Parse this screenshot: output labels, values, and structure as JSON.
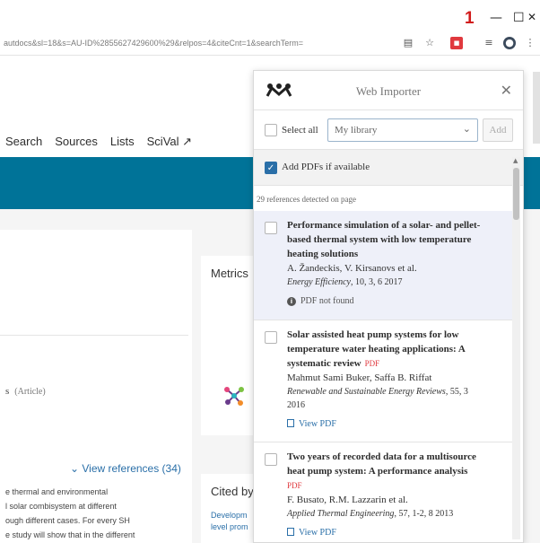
{
  "browser": {
    "annotation_badge": "1",
    "window_buttons": [
      "—",
      "☐",
      "✕"
    ],
    "url": "autdocs&sl=18&s=AU-ID%2855627429600%29&relpos=4&citeCnt=1&searchTerm=",
    "extension_icons": [
      "translate-icon",
      "star-icon",
      "pdf-extension-icon",
      "reading-list-icon",
      "profile-icon",
      "menu-icon"
    ]
  },
  "page": {
    "nav": [
      "Search",
      "Sources",
      "Lists",
      "SciVal ↗"
    ],
    "doc_type_prefix": "s",
    "doc_type": "(Article)",
    "view_references": "⌄ View references (34)",
    "abstract_lines": [
      "e thermal and environmental",
      "l solar combisystem at different",
      "ough different cases. For every SH",
      "e study will show that in the different"
    ],
    "metrics_label": "Metrics",
    "cited_by_label": "Cited by",
    "cited_links": [
      "Developm",
      "level prom"
    ]
  },
  "importer": {
    "title": "Web Importer",
    "select_all": "Select all",
    "library": "My library",
    "add_button": "Add",
    "add_pdfs": "Add PDFs if available",
    "add_pdfs_checked": true,
    "detected": "29 references detected on page",
    "references": [
      {
        "title": "Performance simulation of a solar- and pellet-based thermal system with low temperature heating solutions",
        "pdf_tag": "",
        "authors": "A. Žandeckis, V. Kirsanovs et al.",
        "journal": "Energy Efficiency",
        "volume": ", 10, 3, 6 2017",
        "status": "PDF not found",
        "status_kind": "info"
      },
      {
        "title": "Solar assisted heat pump systems for low temperature water heating applications: A systematic review",
        "pdf_tag": "PDF",
        "authors": "Mahmut Sami Buker, Saffa B. Riffat",
        "journal": "Renewable and Sustainable Energy Reviews",
        "volume": ", 55, 3 2016",
        "status": "View PDF",
        "status_kind": "link"
      },
      {
        "title": "Two years of recorded data for a multisource heat pump system: A performance analysis",
        "pdf_tag": "PDF",
        "authors": "F. Busato, R.M. Lazzarin et al.",
        "journal": "Applied Thermal Engineering",
        "volume": ", 57, 1-2, 8 2013",
        "status": "View PDF",
        "status_kind": "link"
      }
    ]
  },
  "colors": {
    "teal_band": "#007398",
    "link": "#2a6fa8",
    "pdf_tag": "#e0393e",
    "badge": "#d11a1a"
  }
}
